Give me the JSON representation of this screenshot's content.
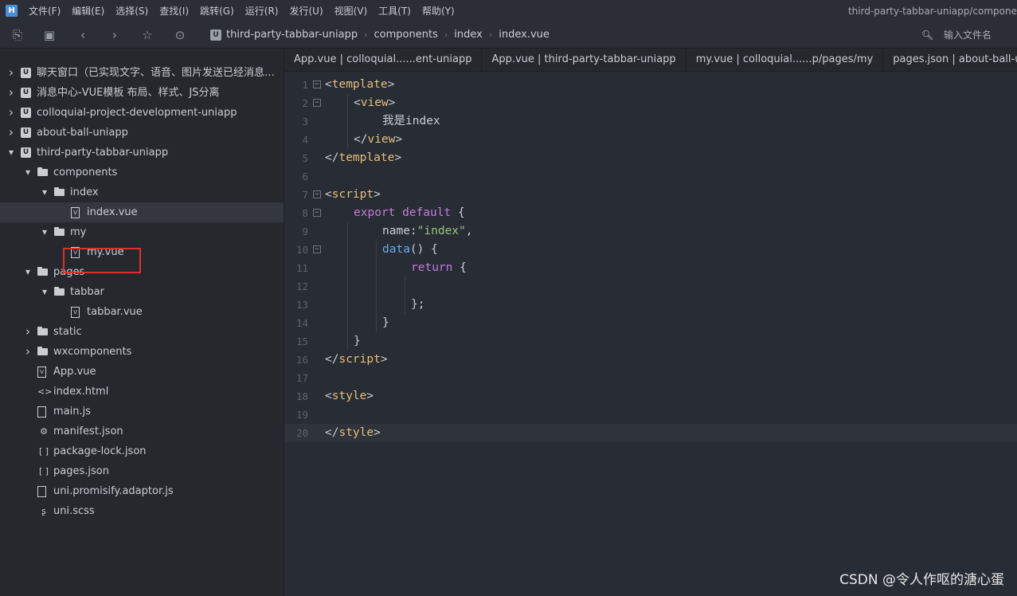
{
  "app": {
    "window_title": "third-party-tabbar-uniapp/compone",
    "menu": [
      "文件(F)",
      "编辑(E)",
      "选择(S)",
      "查找(I)",
      "跳转(G)",
      "运行(R)",
      "发行(U)",
      "视图(V)",
      "工具(T)",
      "帮助(Y)"
    ]
  },
  "toolbar": {
    "breadcrumb": [
      "third-party-tabbar-uniapp",
      "components",
      "index",
      "index.vue"
    ],
    "search_placeholder": "输入文件名"
  },
  "sidebar": {
    "items": [
      {
        "label": "聊天窗口（已实现文字、语音、图片发送已经消息撤回...",
        "type": "project",
        "state": "collapsed"
      },
      {
        "label": "消息中心-VUE模板 布局、样式、JS分离",
        "type": "project",
        "state": "collapsed"
      },
      {
        "label": "colloquial-project-development-uniapp",
        "type": "project",
        "state": "collapsed"
      },
      {
        "label": "about-ball-uniapp",
        "type": "project",
        "state": "collapsed"
      },
      {
        "label": "third-party-tabbar-uniapp",
        "type": "project",
        "state": "expanded"
      },
      {
        "label": "components",
        "type": "folder",
        "state": "expanded"
      },
      {
        "label": "index",
        "type": "folder",
        "state": "expanded"
      },
      {
        "label": "index.vue",
        "type": "vue",
        "selected": true
      },
      {
        "label": "my",
        "type": "folder",
        "state": "expanded"
      },
      {
        "label": "my.vue",
        "type": "vue"
      },
      {
        "label": "pages",
        "type": "folder",
        "state": "expanded"
      },
      {
        "label": "tabbar",
        "type": "folder",
        "state": "expanded"
      },
      {
        "label": "tabbar.vue",
        "type": "vue"
      },
      {
        "label": "static",
        "type": "folder",
        "state": "collapsed"
      },
      {
        "label": "wxcomponents",
        "type": "folder",
        "state": "collapsed"
      },
      {
        "label": "App.vue",
        "type": "vue"
      },
      {
        "label": "index.html",
        "type": "html"
      },
      {
        "label": "main.js",
        "type": "js"
      },
      {
        "label": "manifest.json",
        "type": "manifest"
      },
      {
        "label": "package-lock.json",
        "type": "json"
      },
      {
        "label": "pages.json",
        "type": "json"
      },
      {
        "label": "uni.promisify.adaptor.js",
        "type": "js"
      },
      {
        "label": "uni.scss",
        "type": "scss"
      }
    ]
  },
  "tabs": [
    "App.vue | colloquial......ent-uniapp",
    "App.vue | third-party-tabbar-uniapp",
    "my.vue | colloquial......p/pages/my",
    "pages.json | about-ball-un"
  ],
  "editor": {
    "lines": [
      {
        "n": "1",
        "fold": "⊟",
        "indent": 0,
        "tokens": [
          [
            "t-br",
            "<"
          ],
          [
            "t-tag",
            "template"
          ],
          [
            "t-br",
            ">"
          ]
        ]
      },
      {
        "n": "2",
        "fold": "⊟",
        "indent": 1,
        "tokens": [
          [
            "t-br",
            "<"
          ],
          [
            "t-tag",
            "view"
          ],
          [
            "t-br",
            ">"
          ]
        ]
      },
      {
        "n": "3",
        "fold": "",
        "indent": 2,
        "tokens": [
          [
            "t-prop",
            "我是index"
          ]
        ]
      },
      {
        "n": "4",
        "fold": "",
        "indent": 1,
        "tokens": [
          [
            "t-br",
            "</"
          ],
          [
            "t-tag",
            "view"
          ],
          [
            "t-br",
            ">"
          ]
        ]
      },
      {
        "n": "5",
        "fold": "",
        "indent": 0,
        "tokens": [
          [
            "t-br",
            "</"
          ],
          [
            "t-tag",
            "template"
          ],
          [
            "t-br",
            ">"
          ]
        ]
      },
      {
        "n": "6",
        "fold": "",
        "indent": 0,
        "tokens": []
      },
      {
        "n": "7",
        "fold": "⊟",
        "indent": 0,
        "tokens": [
          [
            "t-br",
            "<"
          ],
          [
            "t-tag",
            "script"
          ],
          [
            "t-br",
            ">"
          ]
        ]
      },
      {
        "n": "8",
        "fold": "⊟",
        "indent": 1,
        "tokens": [
          [
            "t-kw",
            "export default"
          ],
          [
            "t-br",
            " {"
          ]
        ]
      },
      {
        "n": "9",
        "fold": "",
        "indent": 2,
        "tokens": [
          [
            "t-prop",
            "name:"
          ],
          [
            "t-str",
            "\"index\""
          ],
          [
            "t-br",
            ","
          ]
        ]
      },
      {
        "n": "10",
        "fold": "⊟",
        "indent": 2,
        "tokens": [
          [
            "t-fn",
            "data"
          ],
          [
            "t-br",
            "() {"
          ]
        ]
      },
      {
        "n": "11",
        "fold": "",
        "indent": 3,
        "tokens": [
          [
            "t-kw",
            "return"
          ],
          [
            "t-br",
            " {"
          ]
        ]
      },
      {
        "n": "12",
        "fold": "",
        "indent": 3,
        "tokens": []
      },
      {
        "n": "13",
        "fold": "",
        "indent": 3,
        "tokens": [
          [
            "t-br",
            "};"
          ]
        ]
      },
      {
        "n": "14",
        "fold": "",
        "indent": 2,
        "tokens": [
          [
            "t-br",
            "}"
          ]
        ]
      },
      {
        "n": "15",
        "fold": "",
        "indent": 1,
        "tokens": [
          [
            "t-br",
            "}"
          ]
        ]
      },
      {
        "n": "16",
        "fold": "",
        "indent": 0,
        "tokens": [
          [
            "t-br",
            "</"
          ],
          [
            "t-tag",
            "script"
          ],
          [
            "t-br",
            ">"
          ]
        ]
      },
      {
        "n": "17",
        "fold": "",
        "indent": 0,
        "tokens": []
      },
      {
        "n": "18",
        "fold": "",
        "indent": 0,
        "tokens": [
          [
            "t-br",
            "<"
          ],
          [
            "t-tag",
            "style"
          ],
          [
            "t-br",
            ">"
          ]
        ]
      },
      {
        "n": "19",
        "fold": "",
        "indent": 0,
        "tokens": []
      },
      {
        "n": "20",
        "fold": "",
        "indent": 0,
        "tokens": [
          [
            "t-br",
            "</"
          ],
          [
            "t-tag",
            "style"
          ],
          [
            "t-br",
            ">"
          ]
        ],
        "current": true
      }
    ]
  },
  "watermark": "CSDN @令人作呕的溏心蛋",
  "colors": {
    "selection_box": "#e0302a",
    "tag": "#e5c07b",
    "keyword": "#c678dd",
    "string": "#98c379",
    "function": "#61afef"
  }
}
